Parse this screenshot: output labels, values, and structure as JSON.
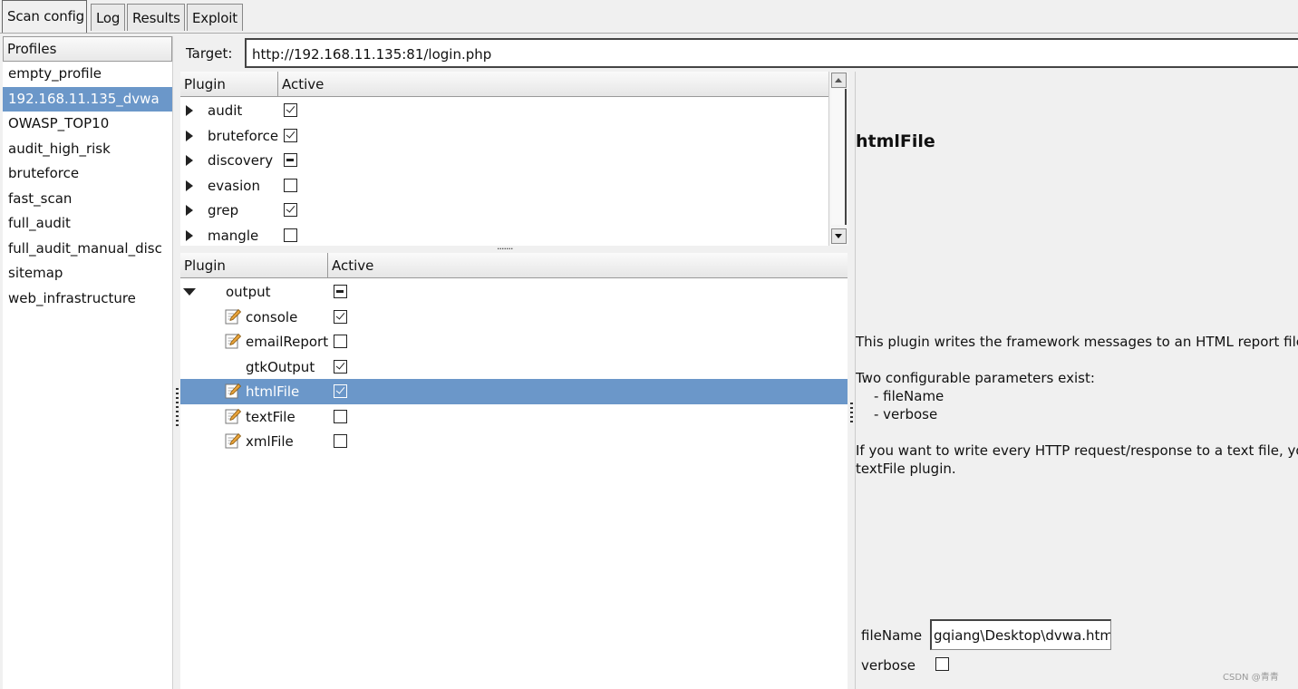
{
  "tabs": [
    "Scan config",
    "Log",
    "Results",
    "Exploit"
  ],
  "profiles": {
    "header": "Profiles",
    "items": [
      "empty_profile",
      "192.168.11.135_dvwa",
      "OWASP_TOP10",
      "audit_high_risk",
      "bruteforce",
      "fast_scan",
      "full_audit",
      "full_audit_manual_disc",
      "sitemap",
      "web_infrastructure"
    ],
    "selected_index": 1
  },
  "target": {
    "label": "Target:",
    "value": "http://192.168.11.135:81/login.php"
  },
  "plugins_top": {
    "col_plugin": "Plugin",
    "col_active": "Active",
    "rows": [
      {
        "name": "audit",
        "state": "checked"
      },
      {
        "name": "bruteforce",
        "state": "checked"
      },
      {
        "name": "discovery",
        "state": "indeterminate"
      },
      {
        "name": "evasion",
        "state": "unchecked"
      },
      {
        "name": "grep",
        "state": "checked"
      },
      {
        "name": "mangle",
        "state": "unchecked"
      }
    ]
  },
  "plugins_bottom": {
    "col_plugin": "Plugin",
    "col_active": "Active",
    "parent": {
      "name": "output",
      "state": "indeterminate"
    },
    "children": [
      {
        "name": "console",
        "state": "checked",
        "configurable": true
      },
      {
        "name": "emailReport",
        "state": "unchecked",
        "configurable": true
      },
      {
        "name": "gtkOutput",
        "state": "checked",
        "configurable": false
      },
      {
        "name": "htmlFile",
        "state": "checked",
        "configurable": true,
        "selected": true
      },
      {
        "name": "textFile",
        "state": "unchecked",
        "configurable": true
      },
      {
        "name": "xmlFile",
        "state": "unchecked",
        "configurable": true
      }
    ]
  },
  "description": {
    "title": "htmlFile",
    "line1": "This plugin writes the framework messages to an HTML report file.",
    "line2": "Two configurable parameters exist:",
    "line3": "    - fileName",
    "line4": "    - verbose",
    "line5": "If you want to write every HTTP request/response to a text file, you s",
    "line6": "textFile plugin."
  },
  "options": {
    "filename_label": "fileName",
    "filename_value": "gqiang\\Desktop\\dvwa.html",
    "verbose_label": "verbose",
    "verbose_checked": false
  },
  "watermark": "CSDN @青青",
  "colors": {
    "selection": "#6b97c9",
    "background": "#f0f0f0"
  }
}
